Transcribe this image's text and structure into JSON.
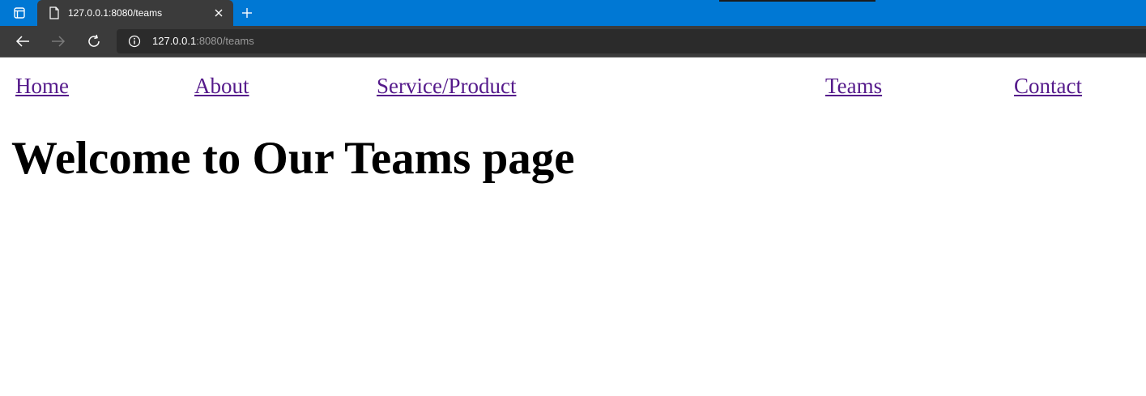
{
  "browser": {
    "tab_title": "127.0.0.1:8080/teams",
    "url_host": "127.0.0.1",
    "url_rest": ":8080/teams"
  },
  "nav": {
    "home": "Home",
    "about": "About",
    "service": "Service/Product",
    "teams": "Teams",
    "contact": "Contact"
  },
  "page": {
    "heading": "Welcome to Our Teams page"
  },
  "colors": {
    "tabstrip": "#0078d4",
    "visited_link": "#551a8b"
  }
}
